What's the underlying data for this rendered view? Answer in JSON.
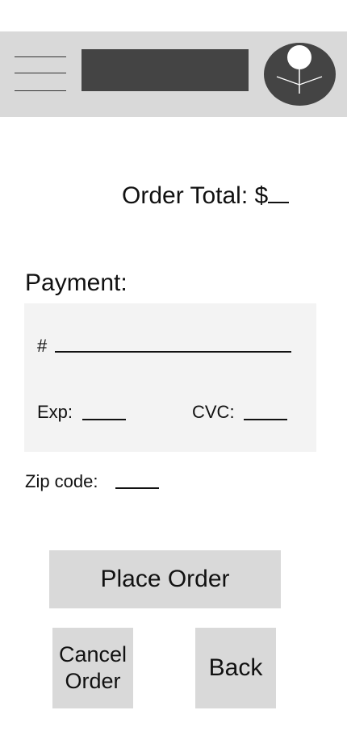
{
  "header": {
    "menu_icon": "hamburger-menu-icon",
    "avatar_icon": "user-avatar-icon"
  },
  "order": {
    "total_label": "Order Total: $"
  },
  "payment": {
    "label": "Payment:",
    "card_number_label": "#",
    "exp_label": "Exp:",
    "cvc_label": "CVC:"
  },
  "zip": {
    "label": "Zip code:"
  },
  "actions": {
    "place_order": "Place Order",
    "cancel_order_line1": "Cancel",
    "cancel_order_line2": "Order",
    "back": "Back"
  },
  "colors": {
    "header_bg": "#d9d9d9",
    "placeholder_dark": "#444444",
    "card_bg": "#f3f3f3",
    "button_bg": "#d9d9d9"
  }
}
